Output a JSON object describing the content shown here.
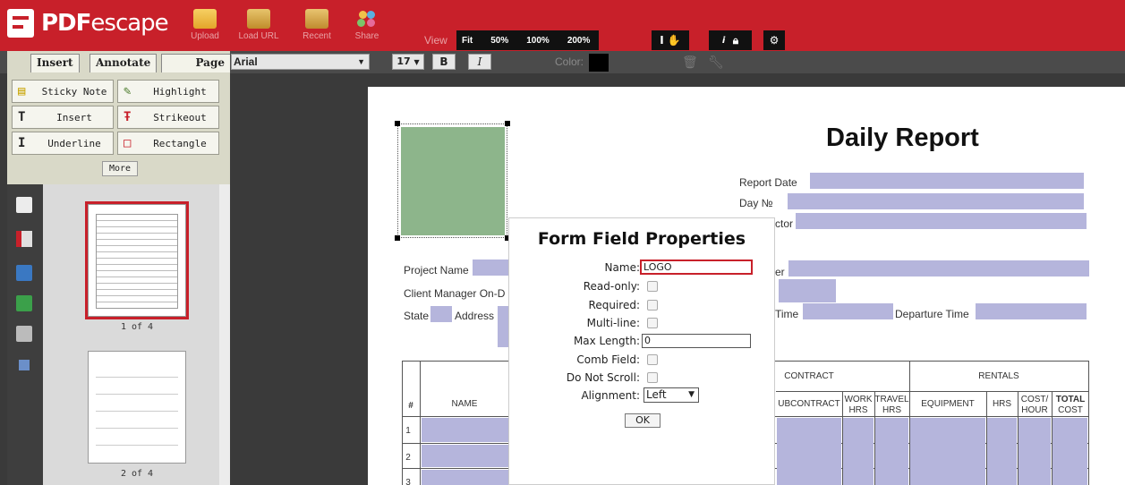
{
  "app": {
    "logo_prefix": "PDF",
    "logo_suffix": "escape"
  },
  "toolbar": {
    "upload": "Upload",
    "load_url": "Load URL",
    "recent": "Recent",
    "share": "Share",
    "view": "View",
    "fit": "Fit",
    "z50": "50%",
    "z100": "100%",
    "z200": "200%",
    "font": "Arial",
    "size": "17",
    "bold": "B",
    "italic": "I",
    "color_label": "Color:"
  },
  "tabs": {
    "insert": "Insert",
    "annotate": "Annotate",
    "page": "Page"
  },
  "tools": {
    "sticky_note": "Sticky Note",
    "highlight": "Highlight",
    "insert": "Insert",
    "strikeout": "Strikeout",
    "underline": "Underline",
    "rectangle": "Rectangle",
    "more": "More"
  },
  "thumbnails": [
    {
      "label": "1 of 4"
    },
    {
      "label": "2 of 4"
    }
  ],
  "document": {
    "title": "Daily Report",
    "report_date": "Report Date",
    "day_no": "Day №",
    "contractor": "ctor",
    "project_name": "Project Name",
    "client_manager": "Client Manager On-D",
    "state": "State",
    "address": "Address",
    "number": "er",
    "arrival_time": "Time",
    "departure_time": "Departure Time",
    "table": {
      "contract": "CONTRACT",
      "rentals": "RENTALS",
      "hash": "#",
      "name": "NAME",
      "subcontract": "UBCONTRACT",
      "work_hrs_1": "WORK",
      "work_hrs_2": "HRS",
      "travel_hrs_1": "TRAVEL",
      "travel_hrs_2": "HRS",
      "equipment": "EQUIPMENT",
      "hrs": "HRS",
      "cost_hour_1": "COST/",
      "cost_hour_2": "HOUR",
      "total_cost_1": "TOTAL",
      "total_cost_2": "COST",
      "rows": [
        "1",
        "2",
        "3"
      ]
    }
  },
  "modal": {
    "title": "Form Field Properties",
    "name_label": "Name:",
    "name_value": "LOGO",
    "readonly_label": "Read-only:",
    "required_label": "Required:",
    "multiline_label": "Multi-line:",
    "maxlen_label": "Max Length:",
    "maxlen_value": "0",
    "comb_label": "Comb Field:",
    "noscroll_label": "Do Not Scroll:",
    "align_label": "Alignment:",
    "align_value": "Left",
    "ok": "OK"
  },
  "colors": {
    "brand_red": "#c8202a",
    "field_fill": "#b5b5dc",
    "logo_fill": "#8db58b"
  }
}
